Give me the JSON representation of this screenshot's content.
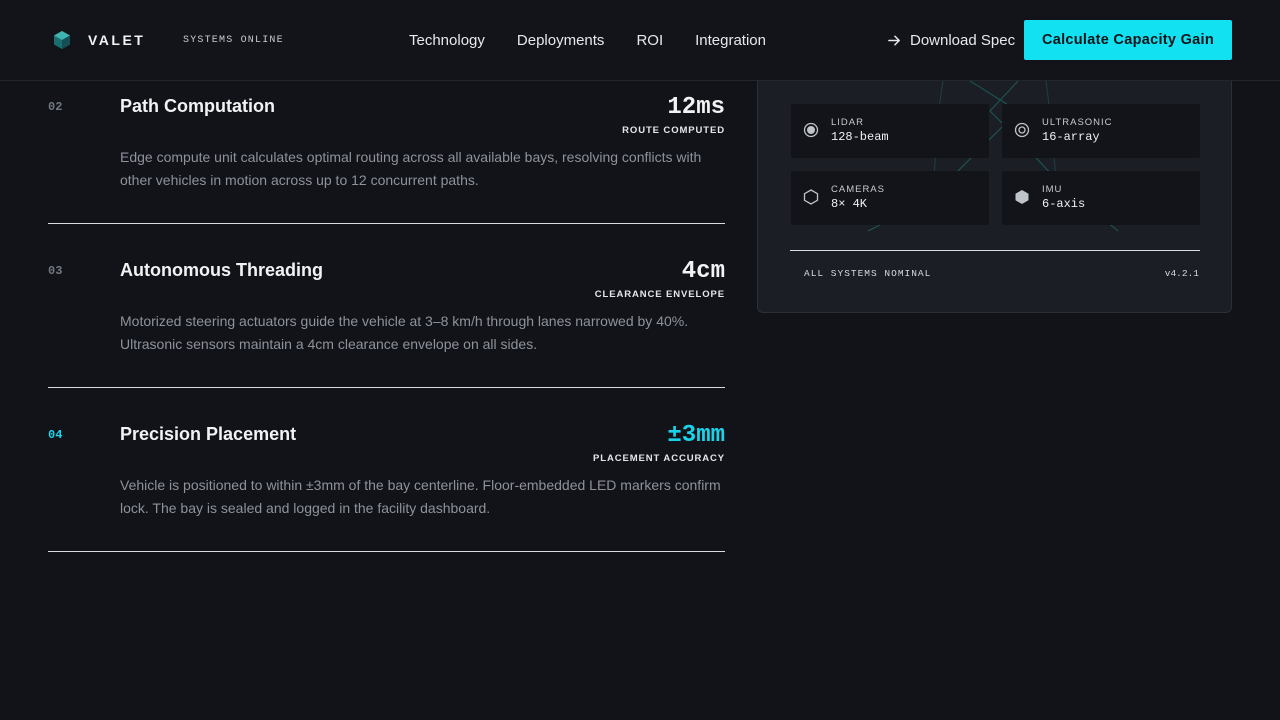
{
  "header": {
    "logo_text": "VALET",
    "status": "SYSTEMS ONLINE",
    "nav": [
      "Technology",
      "Deployments",
      "ROI",
      "Integration"
    ],
    "download_label": "Download Spec",
    "cta_label": "Calculate Capacity Gain"
  },
  "steps": [
    {
      "num": "02",
      "title": "Path Computation",
      "metric": "12ms",
      "metric_label": "ROUTE COMPUTED",
      "desc": "Edge compute unit calculates optimal routing across all available bays, resolving conflicts with other vehicles in motion across up to 12 concurrent paths."
    },
    {
      "num": "03",
      "title": "Autonomous Threading",
      "metric": "4cm",
      "metric_label": "CLEARANCE ENVELOPE",
      "desc": "Motorized steering actuators guide the vehicle at 3–8 km/h through lanes narrowed by 40%. Ultrasonic sensors maintain a 4cm clearance envelope on all sides."
    },
    {
      "num": "04",
      "title": "Precision Placement",
      "metric": "±3mm",
      "metric_label": "PLACEMENT ACCURACY",
      "desc": "Vehicle is positioned to within ±3mm of the bay centerline. Floor-embedded LED markers confirm lock. The bay is sealed and logged in the facility dashboard."
    }
  ],
  "panel": {
    "sensors": [
      {
        "name": "LIDAR",
        "value": "128-beam",
        "icon": "radar-dot-icon"
      },
      {
        "name": "ULTRASONIC",
        "value": "16-array",
        "icon": "target-ring-icon"
      },
      {
        "name": "CAMERAS",
        "value": "8× 4K",
        "icon": "hexagon-outline-icon"
      },
      {
        "name": "IMU",
        "value": "6-axis",
        "icon": "hexagon-solid-icon"
      }
    ],
    "footer_status": "ALL SYSTEMS NOMINAL",
    "version": "v4.2.1"
  },
  "colors": {
    "accent": "#12e1f2",
    "background": "#111318",
    "panel": "#1b1e25"
  }
}
